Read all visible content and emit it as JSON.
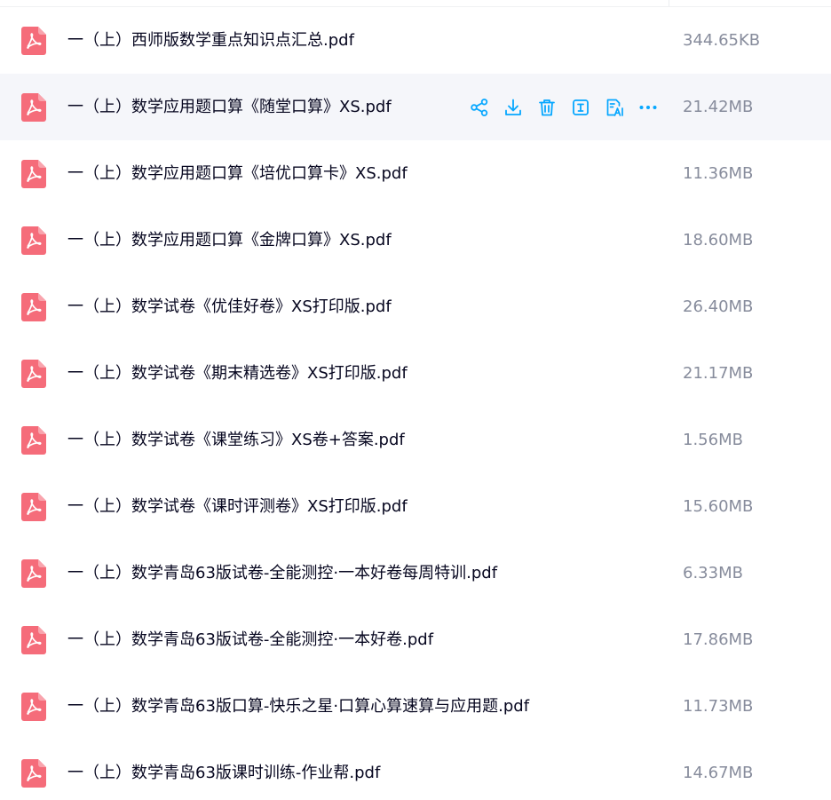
{
  "colors": {
    "accent": "#06a7ff",
    "pdf_icon": "#f56c7a",
    "name_text": "#06061f",
    "size_text": "#878c9c",
    "hover_row": "#f5f6fa"
  },
  "row_actions": [
    {
      "icon": "share-icon",
      "action": "share"
    },
    {
      "icon": "download-icon",
      "action": "download"
    },
    {
      "icon": "delete-icon",
      "action": "delete"
    },
    {
      "icon": "text-extract-icon",
      "action": "extract-text"
    },
    {
      "icon": "ai-document-icon",
      "action": "ai-read"
    },
    {
      "icon": "more-icon",
      "action": "more"
    }
  ],
  "files": [
    {
      "name": "一（上）西师版数学重点知识点汇总.pdf",
      "size": "344.65KB",
      "icon": "pdf-icon",
      "hovered": false
    },
    {
      "name": "一（上）数学应用题口算《随堂口算》XS.pdf",
      "size": "21.42MB",
      "icon": "pdf-icon",
      "hovered": true
    },
    {
      "name": "一（上）数学应用题口算《培优口算卡》XS.pdf",
      "size": "11.36MB",
      "icon": "pdf-icon",
      "hovered": false
    },
    {
      "name": "一（上）数学应用题口算《金牌口算》XS.pdf",
      "size": "18.60MB",
      "icon": "pdf-icon",
      "hovered": false
    },
    {
      "name": "一（上）数学试卷《优佳好卷》XS打印版.pdf",
      "size": "26.40MB",
      "icon": "pdf-icon",
      "hovered": false
    },
    {
      "name": "一（上）数学试卷《期末精选卷》XS打印版.pdf",
      "size": "21.17MB",
      "icon": "pdf-icon",
      "hovered": false
    },
    {
      "name": "一（上）数学试卷《课堂练习》XS卷+答案.pdf",
      "size": "1.56MB",
      "icon": "pdf-icon",
      "hovered": false
    },
    {
      "name": "一（上）数学试卷《课时评测卷》XS打印版.pdf",
      "size": "15.60MB",
      "icon": "pdf-icon",
      "hovered": false
    },
    {
      "name": "一（上）数学青岛63版试卷-全能测控·一本好卷每周特训.pdf",
      "size": "6.33MB",
      "icon": "pdf-icon",
      "hovered": false
    },
    {
      "name": "一（上）数学青岛63版试卷-全能测控·一本好卷.pdf",
      "size": "17.86MB",
      "icon": "pdf-icon",
      "hovered": false
    },
    {
      "name": "一（上）数学青岛63版口算-快乐之星·口算心算速算与应用题.pdf",
      "size": "11.73MB",
      "icon": "pdf-icon",
      "hovered": false
    },
    {
      "name": "一（上）数学青岛63版课时训练-作业帮.pdf",
      "size": "14.67MB",
      "icon": "pdf-icon",
      "hovered": false
    }
  ]
}
